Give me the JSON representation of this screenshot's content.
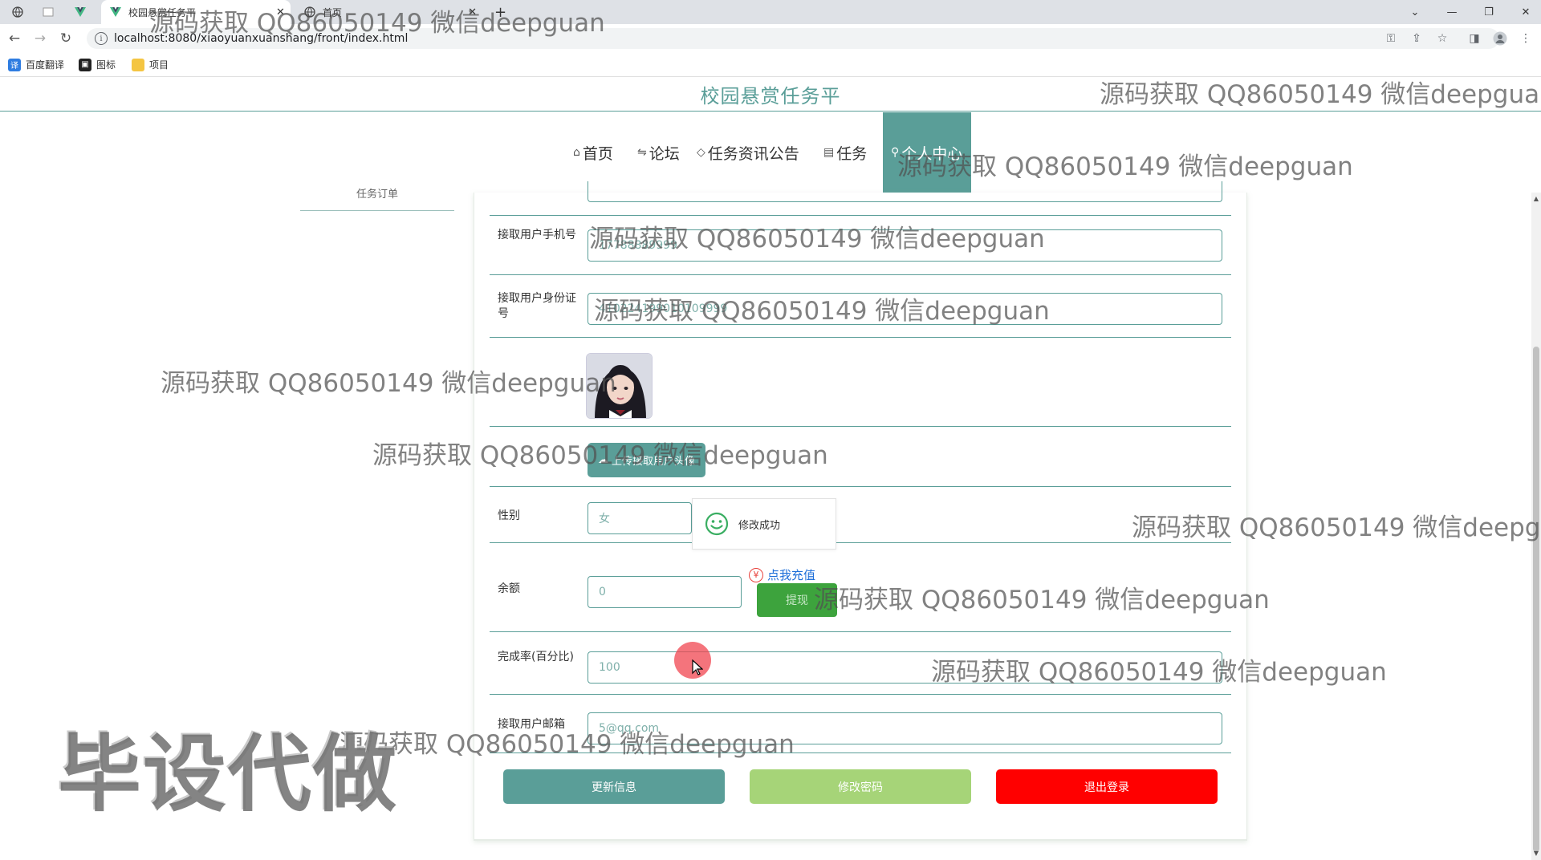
{
  "browser": {
    "tabs": [
      {
        "title": "校园悬赏任务平"
      },
      {
        "title": "首页"
      }
    ],
    "new_tab": "+",
    "url": "localhost:8080/xiaoyuanxuanshang/front/index.html",
    "bookmarks": [
      {
        "label": "百度翻译",
        "icon": "translate-icon"
      },
      {
        "label": "图标",
        "icon": "image-icon"
      },
      {
        "label": "项目",
        "icon": "folder-icon"
      }
    ]
  },
  "site": {
    "title": "校园悬赏任务平",
    "accent_color": "#5a9e98"
  },
  "nav": {
    "items": [
      {
        "label": "首页",
        "icon": "home-icon"
      },
      {
        "label": "论坛",
        "icon": "forum-icon"
      },
      {
        "label": "任务资讯公告",
        "icon": "tag-icon"
      },
      {
        "label": "任务",
        "icon": "task-icon"
      },
      {
        "label": "个人中心",
        "icon": "user-icon"
      }
    ],
    "active": "个人中心"
  },
  "side_menu": {
    "partial_item": "任务订单"
  },
  "form": {
    "phone": {
      "label": "接取用户手机号",
      "value": "17788889999"
    },
    "id_card": {
      "label": "接取用户身份证号",
      "value": "410224199010109999"
    },
    "upload_button": "上传接取用户头像",
    "gender": {
      "label": "性别",
      "value": "女"
    },
    "balance": {
      "label": "余额",
      "value": "0"
    },
    "recharge_link": "点我充值",
    "recharge_icon": "¥",
    "withdraw_button": "提现",
    "completion_rate": {
      "label": "完成率(百分比)",
      "value": "100"
    },
    "email": {
      "label": "接取用户邮箱",
      "value": "5@qq.com"
    }
  },
  "toast": {
    "message": "修改成功"
  },
  "actions": {
    "update": {
      "label": "更新信息",
      "color": "#5a9e98"
    },
    "change_password": {
      "label": "修改密码",
      "color": "#a6d478"
    },
    "logout": {
      "label": "退出登录",
      "color": "#ff0000"
    }
  },
  "watermarks": {
    "repeat": "源码获取 QQ86050149 微信deepguan",
    "big": "毕设代做"
  }
}
